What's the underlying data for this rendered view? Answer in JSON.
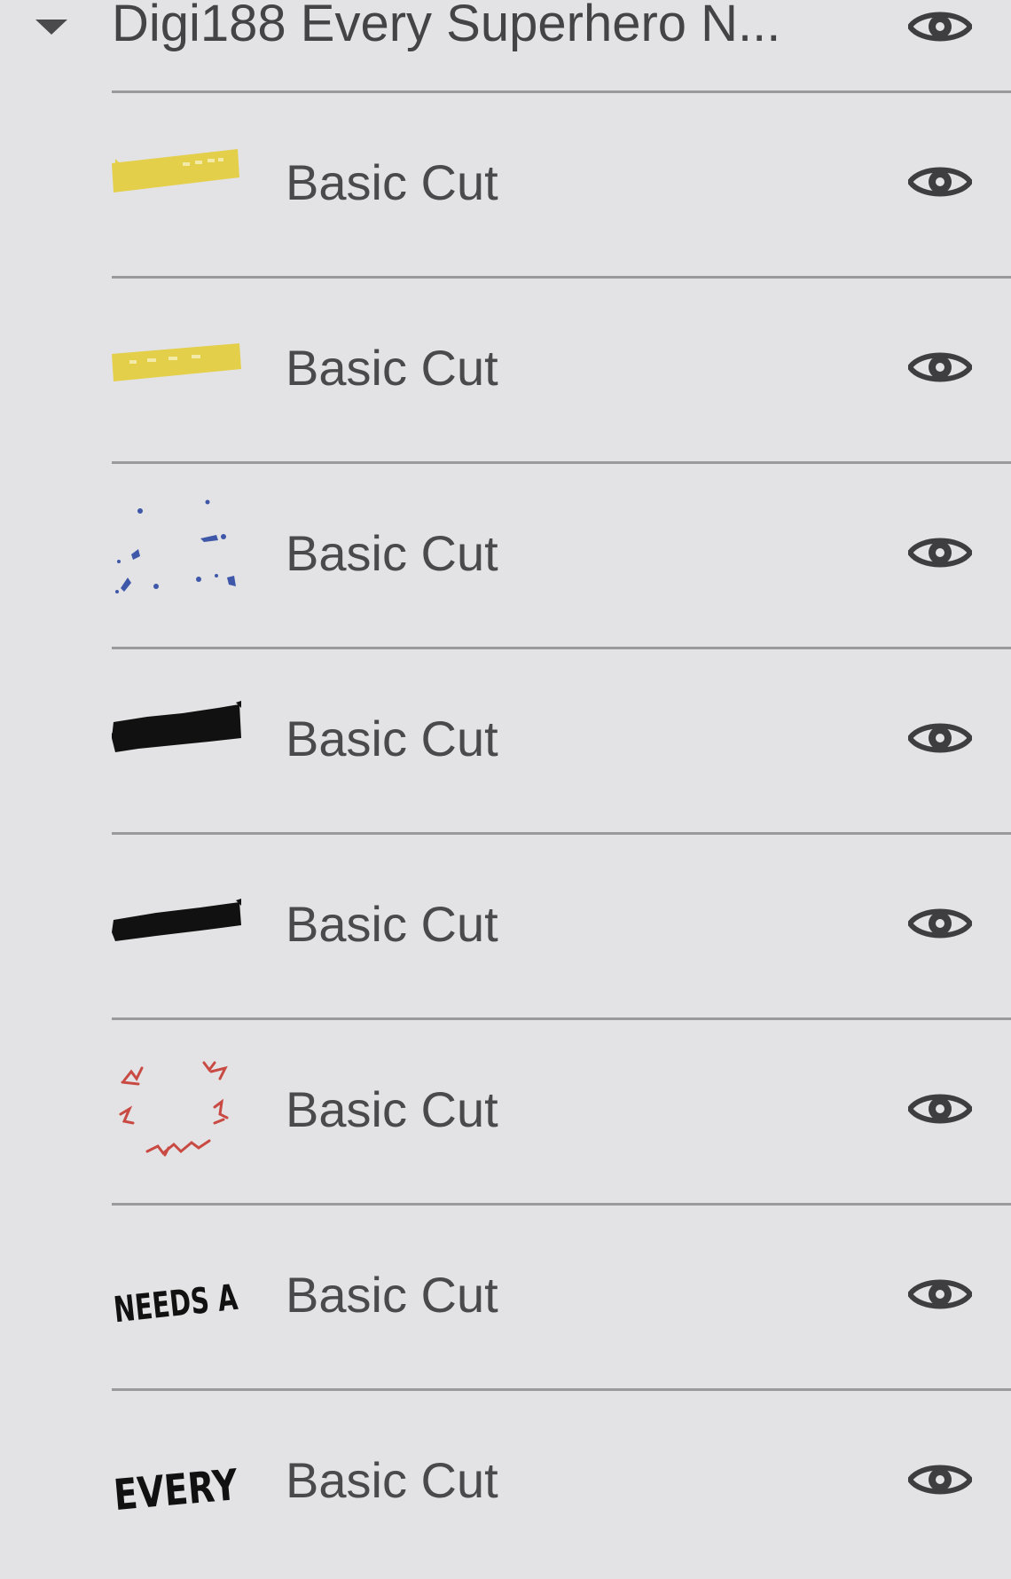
{
  "group": {
    "title": "Digi188 Every Superhero N...",
    "expand_icon": "caret-down-icon",
    "visibility_icon": "eye-icon"
  },
  "layers": [
    {
      "label": "Basic Cut",
      "thumbnail": "yellow-tape-strip",
      "visibility_icon": "eye-icon"
    },
    {
      "label": "Basic Cut",
      "thumbnail": "yellow-tape-strip",
      "visibility_icon": "eye-icon"
    },
    {
      "label": "Basic Cut",
      "thumbnail": "blue-splatter-dots",
      "visibility_icon": "eye-icon"
    },
    {
      "label": "Basic Cut",
      "thumbnail": "black-brush-strip",
      "visibility_icon": "eye-icon"
    },
    {
      "label": "Basic Cut",
      "thumbnail": "black-brush-strip",
      "visibility_icon": "eye-icon"
    },
    {
      "label": "Basic Cut",
      "thumbnail": "red-doodle-wreath",
      "visibility_icon": "eye-icon"
    },
    {
      "label": "Basic Cut",
      "thumbnail": "needs-a-lettering",
      "thumbnail_text": "NEEDS A",
      "visibility_icon": "eye-icon"
    },
    {
      "label": "Basic Cut",
      "thumbnail": "every-lettering",
      "thumbnail_text": "EVERY",
      "visibility_icon": "eye-icon"
    }
  ],
  "colors": {
    "background": "#e3e3e5",
    "text": "#4a4a4c",
    "divider": "#9a9a9c",
    "tape_yellow": "#e3cf4a",
    "splatter_blue": "#3f57a8",
    "doodle_red": "#c94a43",
    "ink_black": "#111111"
  }
}
